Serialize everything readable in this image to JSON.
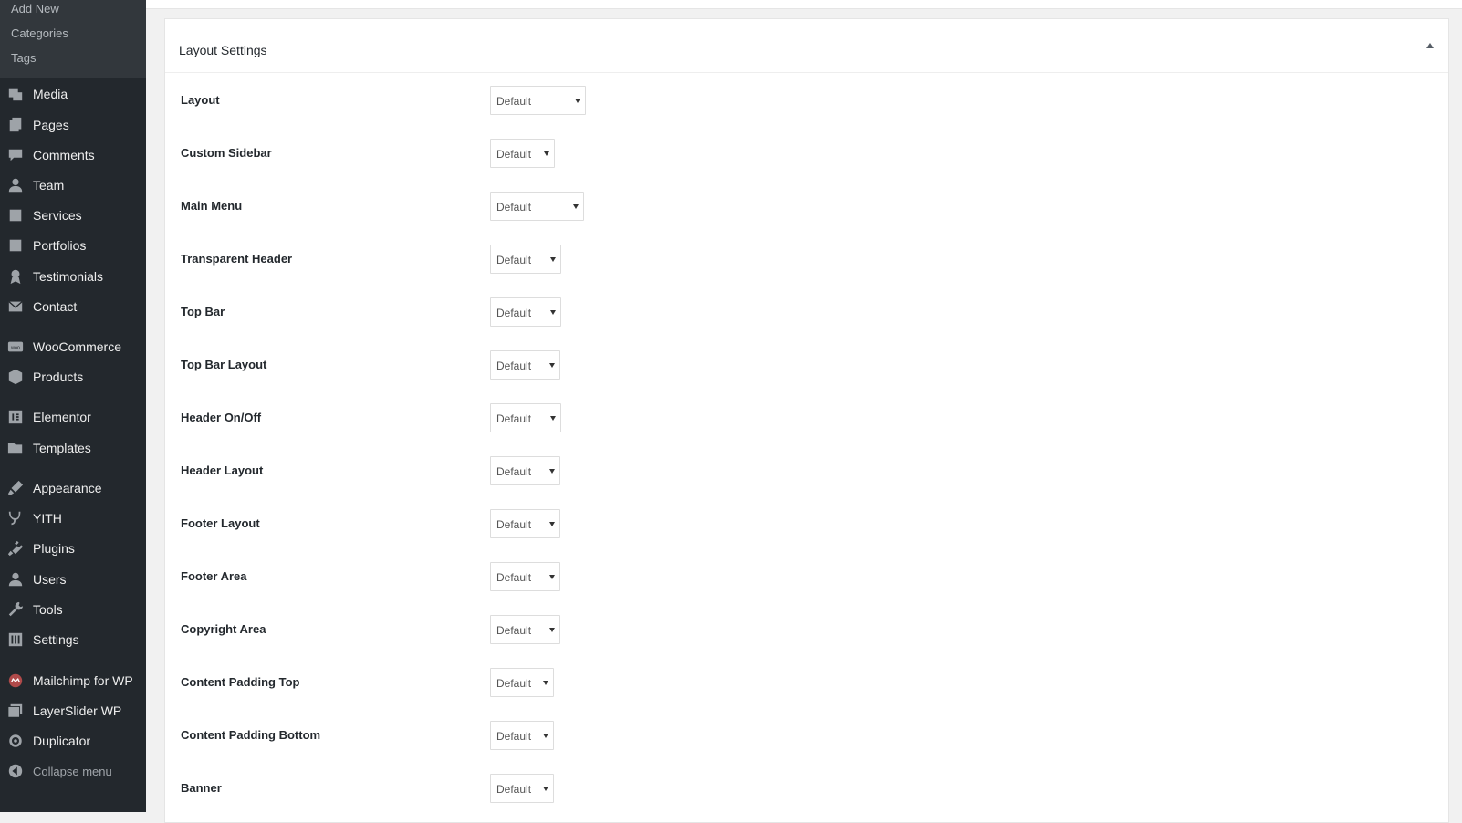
{
  "sidebar": {
    "submenu": [
      "Add New",
      "Categories",
      "Tags"
    ],
    "items": [
      {
        "label": "Media",
        "icon": "media-icon"
      },
      {
        "label": "Pages",
        "icon": "pages-icon"
      },
      {
        "label": "Comments",
        "icon": "comments-icon"
      },
      {
        "label": "Team",
        "icon": "team-icon"
      },
      {
        "label": "Services",
        "icon": "services-icon"
      },
      {
        "label": "Portfolios",
        "icon": "portfolios-icon"
      },
      {
        "label": "Testimonials",
        "icon": "testimonials-icon"
      },
      {
        "label": "Contact",
        "icon": "contact-icon"
      },
      {
        "label": "WooCommerce",
        "icon": "woocommerce-icon"
      },
      {
        "label": "Products",
        "icon": "products-icon"
      },
      {
        "label": "Elementor",
        "icon": "elementor-icon"
      },
      {
        "label": "Templates",
        "icon": "templates-icon"
      },
      {
        "label": "Appearance",
        "icon": "appearance-icon"
      },
      {
        "label": "YITH",
        "icon": "yith-icon"
      },
      {
        "label": "Plugins",
        "icon": "plugins-icon"
      },
      {
        "label": "Users",
        "icon": "users-icon"
      },
      {
        "label": "Tools",
        "icon": "tools-icon"
      },
      {
        "label": "Settings",
        "icon": "settings-icon"
      },
      {
        "label": "Mailchimp for WP",
        "icon": "mailchimp-icon"
      },
      {
        "label": "LayerSlider WP",
        "icon": "layerslider-icon"
      },
      {
        "label": "Duplicator",
        "icon": "duplicator-icon"
      }
    ],
    "collapse_label": "Collapse menu"
  },
  "panel": {
    "title": "Layout Settings",
    "rows": [
      {
        "label": "Layout",
        "value": "Default"
      },
      {
        "label": "Custom Sidebar",
        "value": "Default"
      },
      {
        "label": "Main Menu",
        "value": "Default"
      },
      {
        "label": "Transparent Header",
        "value": "Default"
      },
      {
        "label": "Top Bar",
        "value": "Default"
      },
      {
        "label": "Top Bar Layout",
        "value": "Default"
      },
      {
        "label": "Header On/Off",
        "value": "Default"
      },
      {
        "label": "Header Layout",
        "value": "Default"
      },
      {
        "label": "Footer Layout",
        "value": "Default"
      },
      {
        "label": "Footer Area",
        "value": "Default"
      },
      {
        "label": "Copyright Area",
        "value": "Default"
      },
      {
        "label": "Content Padding Top",
        "value": "Default"
      },
      {
        "label": "Content Padding Bottom",
        "value": "Default"
      },
      {
        "label": "Banner",
        "value": "Default"
      }
    ]
  },
  "colors": {
    "sidebar_bg": "#23282d",
    "submenu_bg": "#32373c",
    "icon": "#9ea3a8",
    "mailchimp_icon": "#b04a4a"
  }
}
